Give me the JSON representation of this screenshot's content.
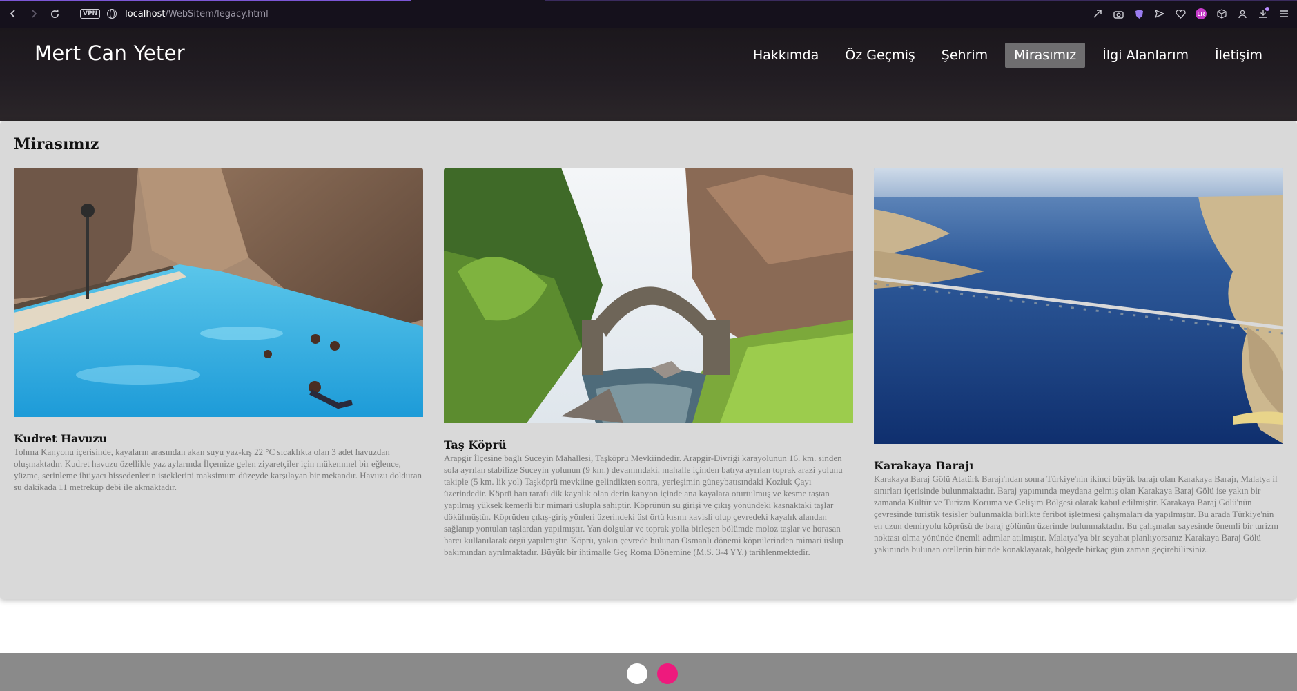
{
  "browser": {
    "back_icon": "chevron-left-icon",
    "forward_icon": "chevron-right-icon",
    "reload_icon": "reload-icon",
    "vpn_label": "VPN",
    "url_host": "localhost",
    "url_path": "/WebSitem/legacy.html",
    "profile_initials": "LR"
  },
  "site": {
    "logo": "Mert Can Yeter",
    "nav": [
      {
        "label": "Hakkımda"
      },
      {
        "label": "Öz Geçmiş"
      },
      {
        "label": "Şehrim"
      },
      {
        "label": "Mirasımız",
        "active": true
      },
      {
        "label": "İlgi Alanlarım"
      },
      {
        "label": "İletişim"
      }
    ]
  },
  "main": {
    "section_title": "Mirasımız",
    "cards": [
      {
        "title": "Kudret Havuzu",
        "image": "canyon-pool-photo",
        "text": "Tohma Kanyonu içerisinde, kayaların arasından akan suyu yaz-kış 22 °C sıcaklıkta olan 3 adet havuzdan oluşmaktadır. Kudret havuzu özellikle yaz aylarında İlçemize gelen ziyaretçiler için mükemmel bir eğlence, yüzme, serinleme ihtiyacı hissedenlerin isteklerini maksimum düzeyde karşılayan bir mekandır. Havuzu dolduran su dakikada 11 metreküp debi ile akmaktadır."
      },
      {
        "title": "Taş Köprü",
        "image": "stone-bridge-photo",
        "text": "Arapgir İlçesine bağlı Suceyin Mahallesi, Taşköprü Mevkiindedir. Arapgir-Divriği karayolunun 16. km. sinden sola ayrılan stabilize Suceyin yolunun (9 km.) devamındaki, mahalle içinden batıya ayrılan toprak arazi yolunu takiple (5 km. lik yol) Taşköprü mevkiine gelindikten sonra, yerleşimin güneybatısındaki Kozluk Çayı üzerindedir. Köprü batı tarafı dik kayalık olan derin kanyon içinde ana kayalara oturtulmuş ve kesme taştan yapılmış yüksek kemerli bir mimari üslupla sahiptir. Köprünün su girişi ve çıkış yönündeki kasnaktaki taşlar dökülmüştür. Köprüden çıkış-giriş yönleri üzerindeki üst örtü kısmı kavisli olup çevredeki kayalık alandan sağlanıp yontulan taşlardan yapılmıştır. Yan dolgular ve toprak yolla birleşen bölümde moloz taşlar ve horasan harcı kullanılarak örgü yapılmıştır. Köprü, yakın çevrede bulunan Osmanlı dönemi köprülerinden mimari üslup bakımından ayrılmaktadır. Büyük bir ihtimalle Geç Roma Dönemine (M.S. 3-4 YY.) tarihlenmektedir."
      },
      {
        "title": "Karakaya Barajı",
        "image": "dam-aerial-photo",
        "text": "Karakaya Baraj Gölü Atatürk Barajı'ndan sonra Türkiye'nin ikinci büyük barajı olan Karakaya Barajı, Malatya il sınırları içerisinde bulunmaktadır. Baraj yapımında meydana gelmiş olan Karakaya Baraj Gölü ise yakın bir zamanda Kültür ve Turizm Koruma ve Gelişim Bölgesi olarak kabul edilmiştir. Karakaya Baraj Gölü'nün çevresinde turistik tesisler bulunmakla birlikte feribot işletmesi çalışmaları da yapılmıştır. Bu arada Türkiye'nin en uzun demiryolu köprüsü de baraj gölünün üzerinde bulunmaktadır. Bu çalışmalar sayesinde önemli bir turizm noktası olma yönünde önemli adımlar atılmıştır. Malatya'ya bir seyahat planlıyorsanız Karakaya Baraj Gölü yakınında bulunan otellerin birinde konaklayarak, bölgede birkaç gün zaman geçirebilirsiniz."
      }
    ]
  },
  "footer": {
    "buttons": [
      "white-circle-button",
      "pink-circle-button"
    ],
    "colors": {
      "white": "#ffffff",
      "pink": "#ee1a7d"
    }
  }
}
